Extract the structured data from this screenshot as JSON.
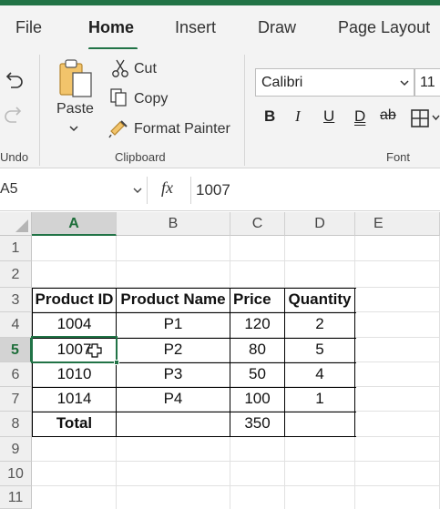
{
  "tabs": [
    {
      "label": "File"
    },
    {
      "label": "Home"
    },
    {
      "label": "Insert"
    },
    {
      "label": "Draw"
    },
    {
      "label": "Page Layout"
    }
  ],
  "ribbon": {
    "undo_group": "Undo",
    "paste_label": "Paste",
    "cut_label": "Cut",
    "copy_label": "Copy",
    "format_painter_label": "Format Painter",
    "clipboard_group": "Clipboard",
    "font_name": "Calibri",
    "font_size": "11",
    "bold": "B",
    "italic": "I",
    "underline": "U",
    "double_underline": "D",
    "strikethrough": "ab",
    "font_group": "Font"
  },
  "formula_bar": {
    "name_box": "A5",
    "fx": "fx",
    "content": "1007"
  },
  "sheet": {
    "columns": [
      "A",
      "B",
      "C",
      "D",
      "E"
    ],
    "rows": [
      "1",
      "2",
      "3",
      "4",
      "5",
      "6",
      "7",
      "8",
      "9",
      "10",
      "11"
    ],
    "header": [
      "Product ID",
      "Product Name",
      "Price",
      "Quantity"
    ],
    "data": [
      [
        "1004",
        "P1",
        "120",
        "2"
      ],
      [
        "1007",
        "P2",
        "80",
        "5"
      ],
      [
        "1010",
        "P3",
        "50",
        "4"
      ],
      [
        "1014",
        "P4",
        "100",
        "1"
      ]
    ],
    "total": [
      "Total",
      "",
      "350",
      ""
    ]
  },
  "colors": {
    "accent": "#217346",
    "ribbon_bg": "#f3f3f3"
  },
  "icons": [
    "undo-icon",
    "redo-icon",
    "paste-icon",
    "chevron-down-icon",
    "scissors-icon",
    "copy-icon",
    "format-painter-icon",
    "fx-icon",
    "borders-icon",
    "cell-cursor-icon"
  ]
}
